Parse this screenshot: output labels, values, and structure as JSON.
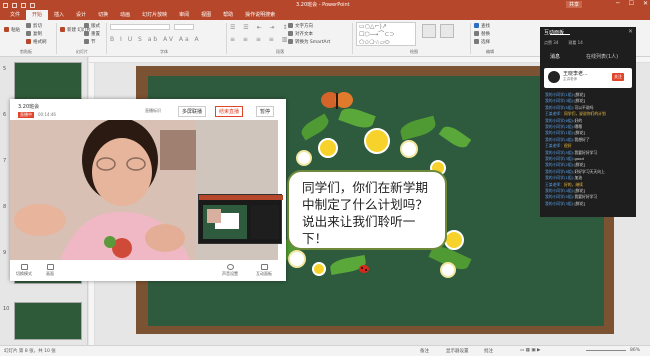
{
  "window": {
    "title": "3.20班会 - PowerPoint",
    "share": "共享"
  },
  "ribbon_tabs": [
    "文件",
    "开始",
    "插入",
    "设计",
    "切换",
    "动画",
    "幻灯片放映",
    "审阅",
    "视图",
    "帮助",
    "操作说明搜索"
  ],
  "ribbon": {
    "paste": "粘贴",
    "cut": "剪切",
    "copy": "复制",
    "format_painter": "格式刷",
    "new_slide": "新建\n幻灯片",
    "layout": "版式",
    "reset": "重置",
    "section": "节",
    "text_direction": "文字方向",
    "align_text": "对齐文本",
    "smartart": "转换为 SmartArt",
    "find": "查找",
    "replace": "替换",
    "select": "选择",
    "groups": {
      "clipboard": "剪贴板",
      "slides": "幻灯片",
      "font": "字体",
      "paragraph": "段落",
      "drawing": "绘图",
      "editing": "编辑"
    }
  },
  "thumbnails": [
    {
      "number": "5"
    },
    {
      "number": "6"
    },
    {
      "number": "7"
    },
    {
      "number": "8"
    },
    {
      "number": "9"
    },
    {
      "number": "10"
    }
  ],
  "slide": {
    "text": "同学们，你们在新学期中制定了什么计划吗？说出来让我们聆听一下！"
  },
  "live_window": {
    "title": "3.20班会",
    "badge": "直播中",
    "time": "00:14:46",
    "net": "直播标识",
    "mode_button": "多屏联播",
    "end_button": "结束直播",
    "pause_button": "暂停",
    "bottom": [
      "切换模式",
      "画面",
      "声音设置",
      "互动面板"
    ]
  },
  "interaction_panel": {
    "title": "互动面板",
    "stats": [
      "点赞 34",
      "观看 14"
    ],
    "tabs": [
      "消息",
      "在线列表(1人)"
    ],
    "presenter_name": "王晓李老...",
    "presenter_sub": "主讲老师",
    "follow": "关注",
    "messages": [
      {
        "user": "我的小同学(1组):",
        "text": "[鲜花]",
        "hl": false
      },
      {
        "user": "我的小同学(3组):",
        "text": "[鲜花]",
        "hl": false
      },
      {
        "user": "我的小同学(5组):",
        "text": "可以不说吗",
        "hl": false
      },
      {
        "user": "王某老师：",
        "text": "同学们，说说你们的计划",
        "hl": true
      },
      {
        "user": "我的小同学(6组):",
        "text": "好的",
        "hl": false
      },
      {
        "user": "我的小同学(2组):",
        "text": "嗯嗯",
        "hl": false
      },
      {
        "user": "我的小同学(1组):",
        "text": "[鲜花]",
        "hl": false
      },
      {
        "user": "我的小同学(4组):",
        "text": "我想好了",
        "hl": false
      },
      {
        "user": "王某老师：",
        "text": "很好",
        "hl": true
      },
      {
        "user": "我的小同学(5组):",
        "text": "我要好好学习",
        "hl": false
      },
      {
        "user": "我的小同学(3组):",
        "text": "good",
        "hl": false
      },
      {
        "user": "我的小同学(2组):",
        "text": "[鲜花]",
        "hl": false
      },
      {
        "user": "我的小同学(6组):",
        "text": "好好学习天天向上",
        "hl": false
      },
      {
        "user": "我的小同学(1组):",
        "text": "加油",
        "hl": false
      },
      {
        "user": "王某老师：",
        "text": "好的，继续",
        "hl": true
      },
      {
        "user": "我的小同学(4组):",
        "text": "[鲜花]",
        "hl": false
      },
      {
        "user": "我的小同学(5组):",
        "text": "我要好好学习",
        "hl": false
      },
      {
        "user": "我的小同学(3组):",
        "text": "[鲜花]",
        "hl": false
      }
    ]
  },
  "status": {
    "slide_info": "幻灯片 第 8 张，共 10 张",
    "notes": "备注",
    "comments": "批注",
    "display": "显示器设置",
    "zoom": "86%"
  },
  "colors": {
    "accent": "#b7472a",
    "board": "#2e5b3e"
  }
}
